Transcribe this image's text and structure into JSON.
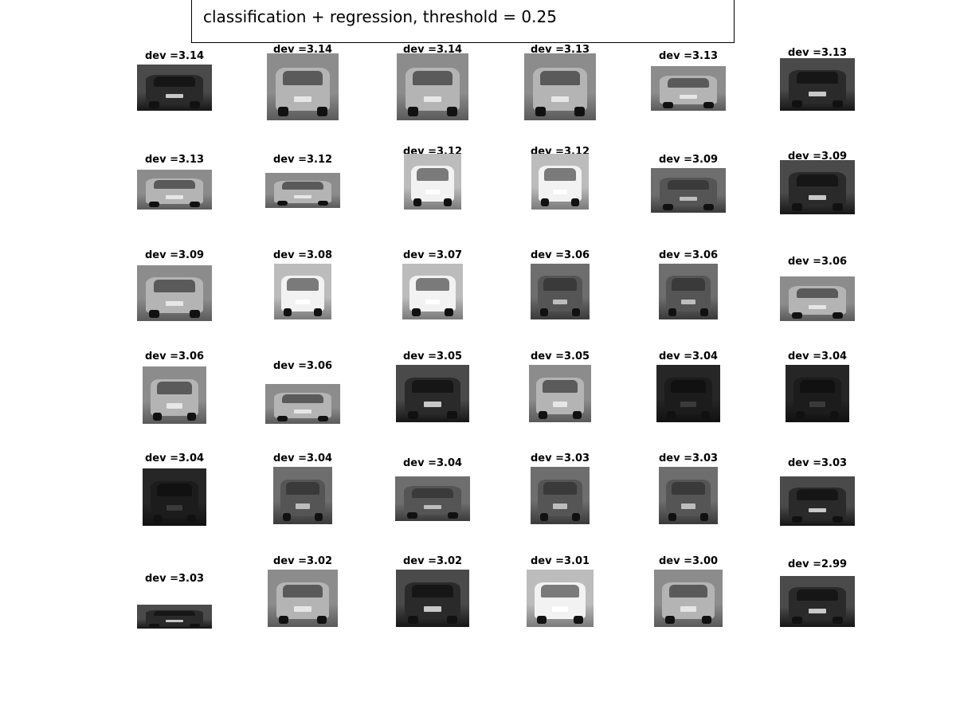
{
  "title": "classification + regression, threshold = 0.25",
  "chart_data": {
    "type": "table",
    "title": "classification + regression, threshold = 0.25",
    "label_prefix": "dev =",
    "rows": 6,
    "cols": 6,
    "values": [
      3.14,
      3.14,
      3.14,
      3.13,
      3.13,
      3.13,
      3.13,
      3.12,
      3.12,
      3.12,
      3.09,
      3.09,
      3.09,
      3.08,
      3.07,
      3.06,
      3.06,
      3.06,
      3.06,
      3.06,
      3.05,
      3.05,
      3.04,
      3.04,
      3.04,
      3.04,
      3.04,
      3.03,
      3.03,
      3.03,
      3.03,
      3.02,
      3.02,
      3.01,
      3.0,
      2.99
    ],
    "labels": [
      "dev =3.14",
      "dev =3.14",
      "dev =3.14",
      "dev =3.13",
      "dev =3.13",
      "dev =3.13",
      "dev =3.13",
      "dev =3.12",
      "dev =3.12",
      "dev =3.12",
      "dev =3.09",
      "dev =3.09",
      "dev =3.09",
      "dev =3.08",
      "dev =3.07",
      "dev =3.06",
      "dev =3.06",
      "dev =3.06",
      "dev =3.06",
      "dev =3.06",
      "dev =3.05",
      "dev =3.05",
      "dev =3.04",
      "dev =3.04",
      "dev =3.04",
      "dev =3.04",
      "dev =3.04",
      "dev =3.03",
      "dev =3.03",
      "dev =3.03",
      "dev =3.03",
      "dev =3.02",
      "dev =3.02",
      "dev =3.01",
      "dev =3.00",
      "dev =2.99"
    ],
    "thumbnail_tones": [
      "dark",
      "light",
      "light",
      "light",
      "light",
      "dark",
      "light",
      "light",
      "bright",
      "bright",
      "mid",
      "dark",
      "light",
      "bright",
      "bright",
      "mid",
      "mid",
      "light",
      "light",
      "light",
      "dark",
      "light",
      "very-dark",
      "very-dark",
      "very-dark",
      "mid",
      "mid",
      "mid",
      "mid",
      "dark",
      "dark",
      "light",
      "dark",
      "bright",
      "light",
      "dark"
    ]
  }
}
